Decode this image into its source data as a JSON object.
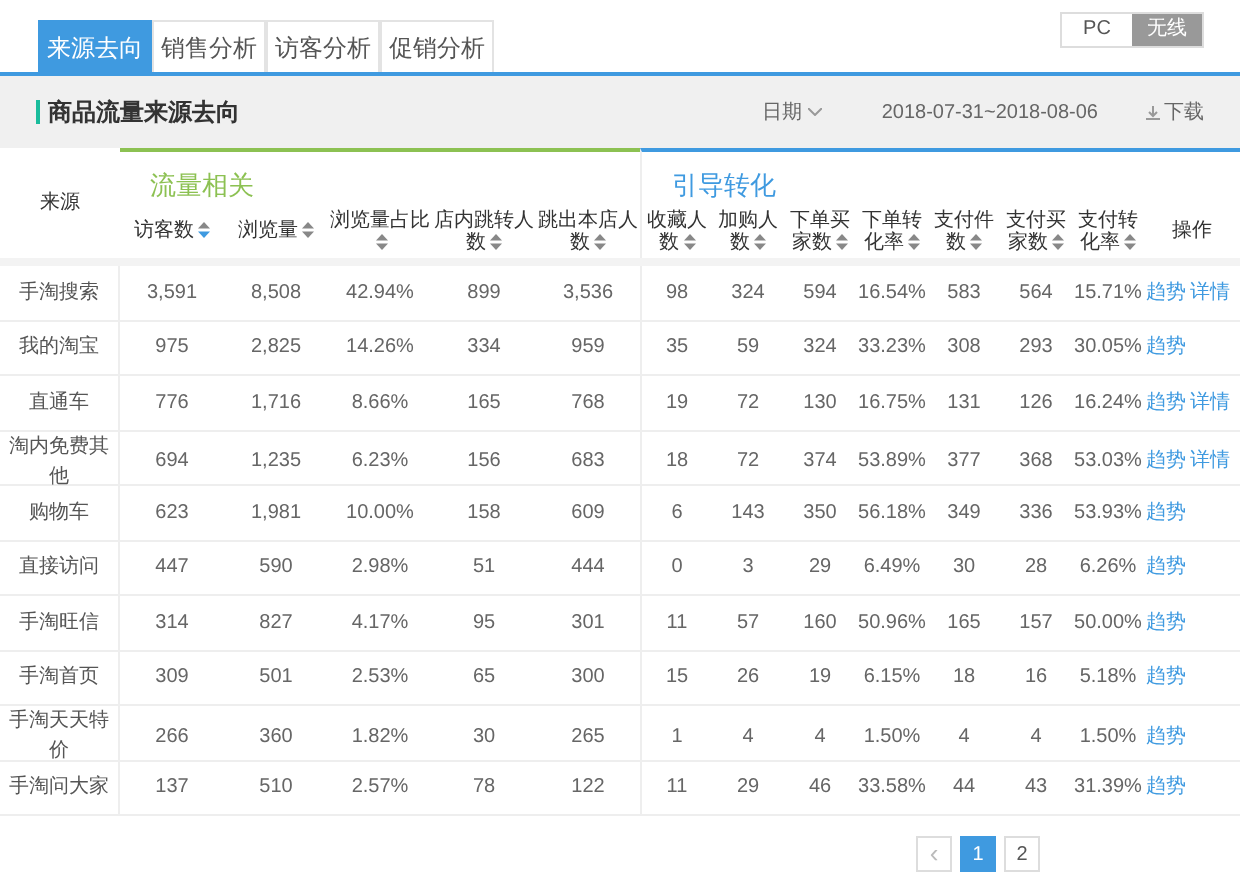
{
  "tabs": [
    {
      "label": "来源去向",
      "selected": true
    },
    {
      "label": "销售分析",
      "selected": false
    },
    {
      "label": "访客分析",
      "selected": false
    },
    {
      "label": "促销分析",
      "selected": false
    }
  ],
  "device_toggle": [
    {
      "label": "PC",
      "selected": false
    },
    {
      "label": "无线",
      "selected": true
    }
  ],
  "panel": {
    "title": "商品流量来源去向",
    "date_label": "日期",
    "date_range": "2018-07-31~2018-08-06",
    "download": "下载"
  },
  "groups": [
    {
      "title": "流量相关",
      "color": "#8cc152"
    },
    {
      "title": "引导转化",
      "color": "#3f9ae0"
    }
  ],
  "source_column": "来源",
  "columns": [
    {
      "label": "访客数",
      "sort_active": true
    },
    {
      "label": "浏览量",
      "sort_active": false
    },
    {
      "label": "浏览量占比",
      "sort_active": false
    },
    {
      "label": "店内跳转人数",
      "sort_active": false
    },
    {
      "label": "跳出本店人数",
      "sort_active": false
    },
    {
      "label": "收藏人数",
      "sort_active": false
    },
    {
      "label": "加购人数",
      "sort_active": false
    },
    {
      "label": "下单买家数",
      "sort_active": false
    },
    {
      "label": "下单转化率",
      "sort_active": false
    },
    {
      "label": "支付件数",
      "sort_active": false
    },
    {
      "label": "支付买家数",
      "sort_active": false
    },
    {
      "label": "支付转化率",
      "sort_active": false
    }
  ],
  "actions_column": "操作",
  "rows": [
    {
      "source": "手淘搜索",
      "values": [
        "3,591",
        "8,508",
        "42.94%",
        "899",
        "3,536",
        "98",
        "324",
        "594",
        "16.54%",
        "583",
        "564",
        "15.71%"
      ],
      "actions": [
        "趋势",
        "详情"
      ]
    },
    {
      "source": "我的淘宝",
      "values": [
        "975",
        "2,825",
        "14.26%",
        "334",
        "959",
        "35",
        "59",
        "324",
        "33.23%",
        "308",
        "293",
        "30.05%"
      ],
      "actions": [
        "趋势"
      ]
    },
    {
      "source": "直通车",
      "values": [
        "776",
        "1,716",
        "8.66%",
        "165",
        "768",
        "19",
        "72",
        "130",
        "16.75%",
        "131",
        "126",
        "16.24%"
      ],
      "actions": [
        "趋势",
        "详情"
      ]
    },
    {
      "source": "淘内免费其他",
      "values": [
        "694",
        "1,235",
        "6.23%",
        "156",
        "683",
        "18",
        "72",
        "374",
        "53.89%",
        "377",
        "368",
        "53.03%"
      ],
      "actions": [
        "趋势",
        "详情"
      ]
    },
    {
      "source": "购物车",
      "values": [
        "623",
        "1,981",
        "10.00%",
        "158",
        "609",
        "6",
        "143",
        "350",
        "56.18%",
        "349",
        "336",
        "53.93%"
      ],
      "actions": [
        "趋势"
      ]
    },
    {
      "source": "直接访问",
      "values": [
        "447",
        "590",
        "2.98%",
        "51",
        "444",
        "0",
        "3",
        "29",
        "6.49%",
        "30",
        "28",
        "6.26%"
      ],
      "actions": [
        "趋势"
      ]
    },
    {
      "source": "手淘旺信",
      "values": [
        "314",
        "827",
        "4.17%",
        "95",
        "301",
        "11",
        "57",
        "160",
        "50.96%",
        "165",
        "157",
        "50.00%"
      ],
      "actions": [
        "趋势"
      ]
    },
    {
      "source": "手淘首页",
      "values": [
        "309",
        "501",
        "2.53%",
        "65",
        "300",
        "15",
        "26",
        "19",
        "6.15%",
        "18",
        "16",
        "5.18%"
      ],
      "actions": [
        "趋势"
      ]
    },
    {
      "source": "手淘天天特价",
      "values": [
        "266",
        "360",
        "1.82%",
        "30",
        "265",
        "1",
        "4",
        "4",
        "1.50%",
        "4",
        "4",
        "1.50%"
      ],
      "actions": [
        "趋势"
      ]
    },
    {
      "source": "手淘问大家",
      "values": [
        "137",
        "510",
        "2.57%",
        "78",
        "122",
        "11",
        "29",
        "46",
        "33.58%",
        "44",
        "43",
        "31.39%"
      ],
      "actions": [
        "趋势"
      ]
    }
  ],
  "pagination": [
    {
      "label": "‹",
      "kind": "prev",
      "selected": false
    },
    {
      "label": "1",
      "kind": "page",
      "selected": true
    },
    {
      "label": "2",
      "kind": "page",
      "selected": false
    }
  ]
}
